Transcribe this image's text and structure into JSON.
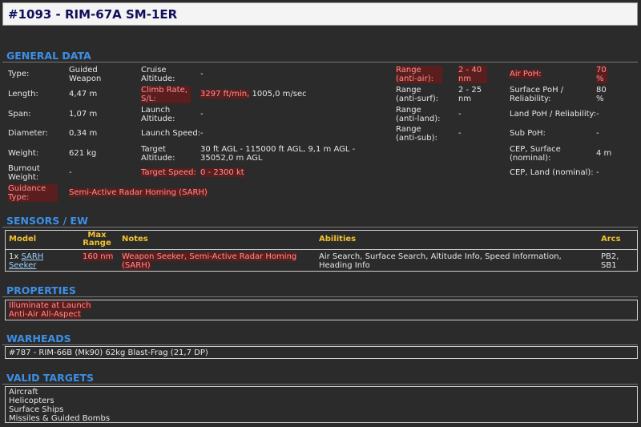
{
  "title": "#1093 - RIM-67A SM-1ER",
  "sections": {
    "general": "GENERAL DATA",
    "sensors": "SENSORS / EW",
    "properties": "PROPERTIES",
    "warheads": "WARHEADS",
    "targets": "VALID TARGETS"
  },
  "general": {
    "type_label": "Type:",
    "type_value": "Guided Weapon",
    "length_label": "Length:",
    "length_value": "4,47 m",
    "span_label": "Span:",
    "span_value": "1,07 m",
    "diameter_label": "Diameter:",
    "diameter_value": "0,34 m",
    "weight_label": "Weight:",
    "weight_value": "621 kg",
    "burnout_label": "Burnout Weight:",
    "burnout_value": "-",
    "guidance_label": "Guidance Type:",
    "guidance_value": "Semi-Active Radar Homing (SARH)",
    "cruise_label": "Cruise Altitude:",
    "cruise_value": "-",
    "climb_label": "Climb Rate, S/L:",
    "climb_value_hl": "3297 ft/min,",
    "climb_value_rest": "1005,0 m/sec",
    "launch_alt_label": "Launch Altitude:",
    "launch_alt_value": "-",
    "launch_speed_label": "Launch Speed:",
    "launch_speed_value": "-",
    "target_alt_label": "Target Altitude:",
    "target_alt_value": "30 ft AGL - 115000 ft AGL, 9,1 m AGL - 35052,0 m AGL",
    "target_speed_label": "Target Speed:",
    "target_speed_value": "0 - 2300 kt",
    "range_air_label": "Range (anti-air):",
    "range_air_value": "2 - 40 nm",
    "range_surf_label": "Range (anti-surf):",
    "range_surf_value": "2 - 25 nm",
    "range_land_label": "Range (anti-land):",
    "range_land_value": "-",
    "range_sub_label": "Range (anti-sub):",
    "range_sub_value": "-",
    "air_poh_label": "Air PoH:",
    "air_poh_value": "70 %",
    "surface_poh_label": "Surface PoH / Reliability:",
    "surface_poh_value": "80 %",
    "land_poh_label": "Land PoH / Reliability:",
    "land_poh_value": "-",
    "sub_poh_label": "Sub PoH:",
    "sub_poh_value": "-",
    "cep_surface_label": "CEP, Surface (nominal):",
    "cep_surface_value": "4 m",
    "cep_land_label": "CEP, Land (nominal):",
    "cep_land_value": "-"
  },
  "sensors": {
    "headers": {
      "model": "Model",
      "max_range": "Max Range",
      "notes": "Notes",
      "abilities": "Abilities",
      "arcs": "Arcs"
    },
    "row": {
      "qty": "1x",
      "model_link": "SARH Seeker",
      "max_range": "160 nm",
      "notes": "Weapon Seeker, Semi-Active Radar Homing (SARH)",
      "abilities": "Air Search, Surface Search, Altitude Info, Speed Information, Heading Info",
      "arcs": "PB2, SB1"
    }
  },
  "properties": [
    "Illuminate at Launch",
    "Anti-Air All-Aspect"
  ],
  "warheads": [
    "#787 - RIM-66B (Mk90) 62kg Blast-Frag (21,7 DP)"
  ],
  "targets": [
    "Aircraft",
    "Helicopters",
    "Surface Ships",
    "Missiles & Guided Bombs"
  ],
  "colors": {
    "highlight_bg": "#5a1e1e",
    "highlight_text": "#ff8f8f",
    "section_blue": "#3d8fe6",
    "sensor_header": "#f2c233"
  }
}
